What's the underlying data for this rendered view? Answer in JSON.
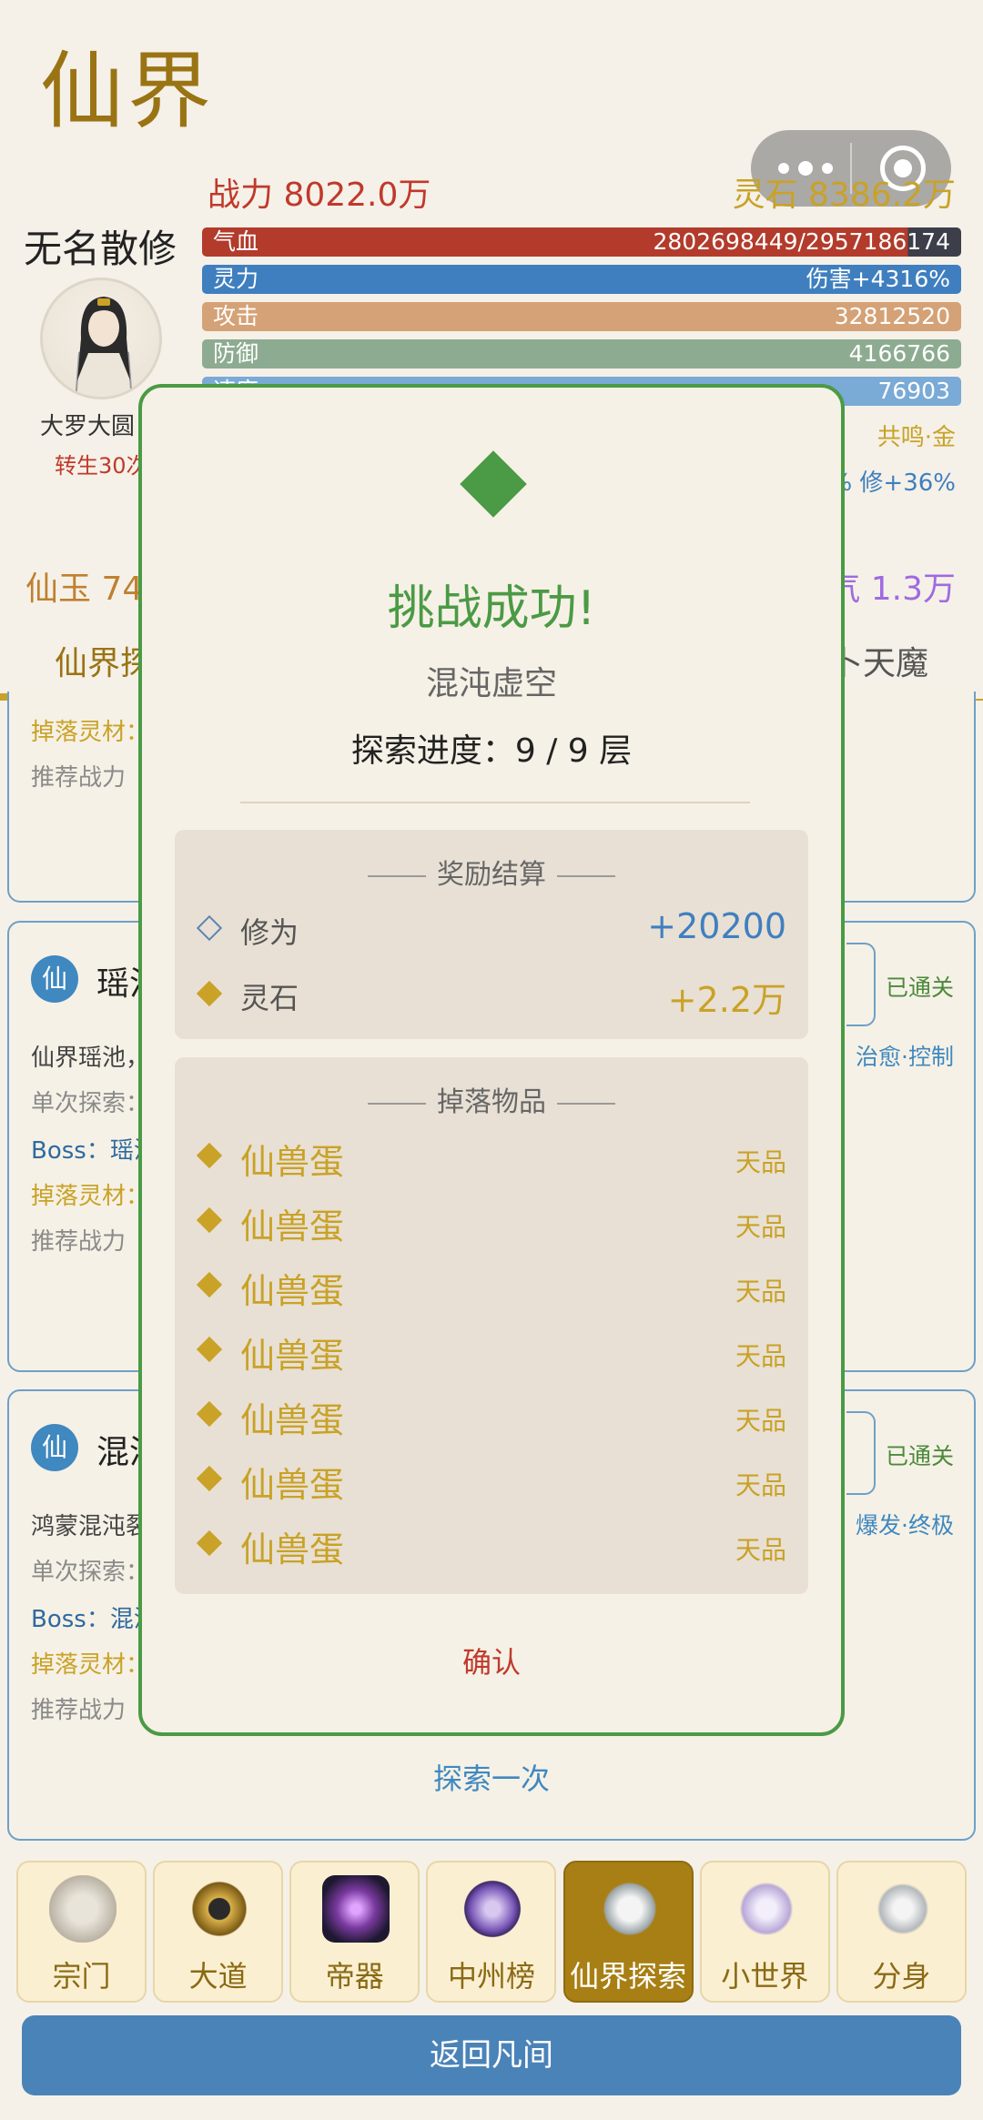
{
  "header": {
    "title": "仙界",
    "power": "战力 8022.0万",
    "spirit_stones": "灵石 8386.2万"
  },
  "player": {
    "name": "无名散修",
    "realm": "大罗大圆",
    "rebirth": "转生30次"
  },
  "stats": {
    "hp": {
      "label": "气血",
      "value": "2802698449/2957186174",
      "fill": 0.948
    },
    "mp": {
      "label": "灵力",
      "value": "伤害+4316%"
    },
    "attack": {
      "label": "攻击",
      "value": "32812520"
    },
    "defense": {
      "label": "防御",
      "value": "4166766"
    },
    "speed": {
      "label": "速度",
      "value": "76903"
    },
    "resonance": "共鸣·金",
    "bonus": "% 修+36%"
  },
  "currency": {
    "jade": "仙玉 74",
    "qi": "气 1.3万"
  },
  "tabs": {
    "left": "仙界探",
    "right": "卜天魔"
  },
  "cards": [
    {
      "drop_label": "掉落灵材：",
      "recommend": "推荐战力"
    },
    {
      "badge": "仙",
      "name": "瑶池",
      "status": "已通关",
      "tags": "治愈·控制",
      "desc": "仙界瑶池，",
      "single": "单次探索：",
      "boss": "Boss：瑶池",
      "drop_label": "掉落灵材：",
      "recommend": "推荐战力"
    },
    {
      "badge": "仙",
      "name": "混沌",
      "status": "已通关",
      "tags": "爆发·终极",
      "desc": "鸿蒙混沌裂",
      "single": "单次探索：",
      "boss": "Boss：混沌",
      "drop_label": "掉落灵材：",
      "recommend": "推荐战力"
    }
  ],
  "explore_once": "探索一次",
  "nav": [
    {
      "label": "宗门",
      "icon": "sect-icon"
    },
    {
      "label": "大道",
      "icon": "taiji-icon"
    },
    {
      "label": "帝器",
      "icon": "artifact-icon"
    },
    {
      "label": "中州榜",
      "icon": "ranking-icon"
    },
    {
      "label": "仙界探索",
      "icon": "explore-icon",
      "active": true
    },
    {
      "label": "小世界",
      "icon": "world-icon"
    },
    {
      "label": "分身",
      "icon": "clone-icon"
    }
  ],
  "return_button": "返回凡间",
  "modal": {
    "title": "挑战成功!",
    "location": "混沌虚空",
    "progress": "探索进度：9 / 9 层",
    "reward_header": "奖励结算",
    "rewards": [
      {
        "label": "修为",
        "value": "+20200",
        "color": "#3f7fbf"
      },
      {
        "label": "灵石",
        "value": "+2.2万",
        "color": "#c9a227"
      }
    ],
    "drop_header": "掉落物品",
    "drops": [
      {
        "name": "仙兽蛋",
        "grade": "天品"
      },
      {
        "name": "仙兽蛋",
        "grade": "天品"
      },
      {
        "name": "仙兽蛋",
        "grade": "天品"
      },
      {
        "name": "仙兽蛋",
        "grade": "天品"
      },
      {
        "name": "仙兽蛋",
        "grade": "天品"
      },
      {
        "name": "仙兽蛋",
        "grade": "天品"
      },
      {
        "name": "仙兽蛋",
        "grade": "天品"
      }
    ],
    "confirm": "确认"
  },
  "colors": {
    "success": "#4b9a45",
    "gold": "#c9a227",
    "blue": "#3f7fbf",
    "red": "#c0392b"
  }
}
